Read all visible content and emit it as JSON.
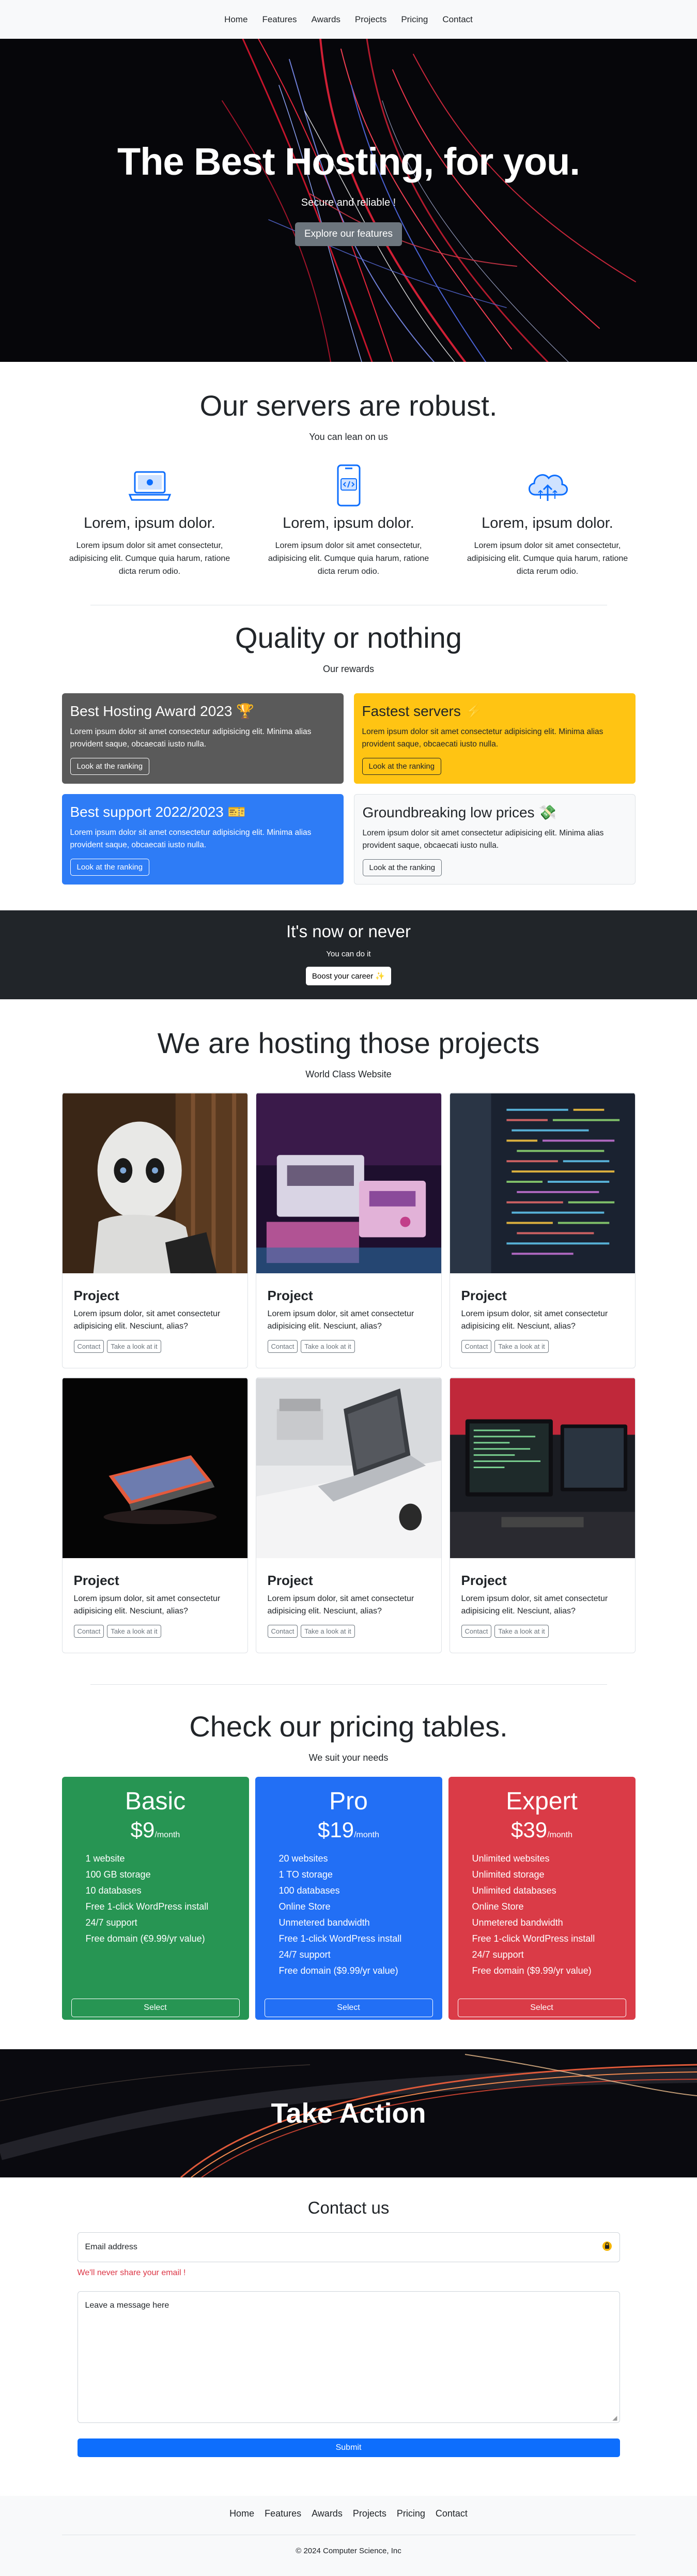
{
  "nav": {
    "items": [
      "Home",
      "Features",
      "Awards",
      "Projects",
      "Pricing",
      "Contact"
    ]
  },
  "hero": {
    "title": "The Best Hosting, for you.",
    "subtitle": "Secure and reliable !",
    "button": "Explore our features"
  },
  "servers": {
    "title": "Our servers are robust.",
    "subtitle": "You can lean on us",
    "items": [
      {
        "icon": "laptop-icon",
        "title": "Lorem, ipsum dolor.",
        "text": "Lorem ipsum dolor sit amet consectetur, adipisicing elit. Cumque quia harum, ratione dicta rerum odio."
      },
      {
        "icon": "phone-code-icon",
        "title": "Lorem, ipsum dolor.",
        "text": "Lorem ipsum dolor sit amet consectetur, adipisicing elit. Cumque quia harum, ratione dicta rerum odio."
      },
      {
        "icon": "cloud-upload-icon",
        "title": "Lorem, ipsum dolor.",
        "text": "Lorem ipsum dolor sit amet consectetur, adipisicing elit. Cumque quia harum, ratione dicta rerum odio."
      }
    ]
  },
  "quality": {
    "title": "Quality or nothing",
    "subtitle": "Our rewards",
    "awards": [
      {
        "title": "Best Hosting Award 2023 🏆",
        "text": "Lorem ipsum dolor sit amet consectetur adipisicing elit. Minima alias provident saque, obcaecati iusto nulla.",
        "button": "Look at the ranking"
      },
      {
        "title": "Fastest servers ⚡",
        "text": "Lorem ipsum dolor sit amet consectetur adipisicing elit. Minima alias provident saque, obcaecati iusto nulla.",
        "button": "Look at the ranking"
      },
      {
        "title": "Best support 2022/2023 🎫",
        "text": "Lorem ipsum dolor sit amet consectetur adipisicing elit. Minima alias provident saque, obcaecati iusto nulla.",
        "button": "Look at the ranking"
      },
      {
        "title": "Groundbreaking low prices 💸",
        "text": "Lorem ipsum dolor sit amet consectetur adipisicing elit. Minima alias provident saque, obcaecati iusto nulla.",
        "button": "Look at the ranking"
      }
    ]
  },
  "cta": {
    "title": "It's now or never",
    "subtitle": "You can do it",
    "button": "Boost your career ✨"
  },
  "projects": {
    "title": "We are hosting those projects",
    "subtitle": "World Class Website",
    "items": [
      {
        "title": "Project",
        "text": "Lorem ipsum dolor, sit amet consectetur adipisicing elit. Nesciunt, alias?",
        "btn1": "Contact",
        "btn2": "Take a look at it",
        "image": "robot"
      },
      {
        "title": "Project",
        "text": "Lorem ipsum dolor, sit amet consectetur adipisicing elit. Nesciunt, alias?",
        "btn1": "Contact",
        "btn2": "Take a look at it",
        "image": "retro-console"
      },
      {
        "title": "Project",
        "text": "Lorem ipsum dolor, sit amet consectetur adipisicing elit. Nesciunt, alias?",
        "btn1": "Contact",
        "btn2": "Take a look at it",
        "image": "code-screen"
      },
      {
        "title": "Project",
        "text": "Lorem ipsum dolor, sit amet consectetur adipisicing elit. Nesciunt, alias?",
        "btn1": "Contact",
        "btn2": "Take a look at it",
        "image": "laptop-dark"
      },
      {
        "title": "Project",
        "text": "Lorem ipsum dolor, sit amet consectetur adipisicing elit. Nesciunt, alias?",
        "btn1": "Contact",
        "btn2": "Take a look at it",
        "image": "laptop-desk"
      },
      {
        "title": "Project",
        "text": "Lorem ipsum dolor, sit amet consectetur adipisicing elit. Nesciunt, alias?",
        "btn1": "Contact",
        "btn2": "Take a look at it",
        "image": "monitors"
      }
    ]
  },
  "pricing": {
    "title": "Check our pricing tables.",
    "subtitle": "We suit your needs",
    "plans": [
      {
        "name": "Basic",
        "price": "$9",
        "period": "/month",
        "color": "#279553",
        "features": [
          "1 website",
          "100 GB storage",
          "10 databases",
          "Free 1-click WordPress install",
          "24/7 support",
          "Free domain (€9.99/yr value)"
        ],
        "button": "Select"
      },
      {
        "name": "Pro",
        "price": "$19",
        "period": "/month",
        "color": "#226ff5",
        "features": [
          "20 websites",
          "1 TO storage",
          "100 databases",
          "Online Store",
          "Unmetered bandwidth",
          "Free 1-click WordPress install",
          "24/7 support",
          "Free domain ($9.99/yr value)"
        ],
        "button": "Select"
      },
      {
        "name": "Expert",
        "price": "$39",
        "period": "/month",
        "color": "#da3b47",
        "features": [
          "Unlimited websites",
          "Unlimited storage",
          "Unlimited databases",
          "Online Store",
          "Unmetered bandwidth",
          "Free 1-click WordPress install",
          "24/7 support",
          "Free domain ($9.99/yr value)"
        ],
        "button": "Select"
      }
    ]
  },
  "action": {
    "title": "Take Action"
  },
  "contact": {
    "title": "Contact us",
    "email_placeholder": "Email address",
    "hint": "We'll never share your email !",
    "message_placeholder": "Leave a message here",
    "submit": "Submit"
  },
  "footer": {
    "items": [
      "Home",
      "Features",
      "Awards",
      "Projects",
      "Pricing",
      "Contact"
    ],
    "copyright": "© 2024 Computer Science, Inc"
  }
}
